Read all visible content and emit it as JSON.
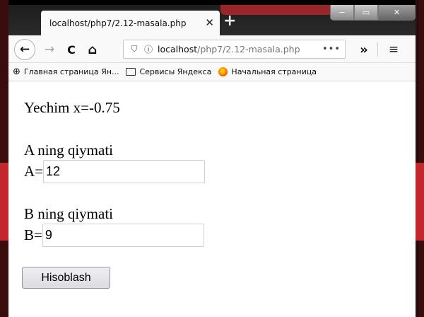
{
  "browser": {
    "tab": {
      "title": "localhost/php7/2.12-masala.php",
      "close_glyph": "✕"
    },
    "new_tab_glyph": "+",
    "window_controls": {
      "minimize": "−",
      "maximize": "▭",
      "close": "✕"
    },
    "nav": {
      "back_glyph": "←",
      "forward_glyph": "→",
      "reload_glyph": "C",
      "home_glyph": "⌂",
      "overflow_glyph": "»",
      "menu_glyph": "≡"
    },
    "url": {
      "host": "localhost",
      "path": "/php7/2.12-masala.php",
      "more": "•••",
      "shield_glyph": "⛉",
      "info_glyph": "ⓘ"
    },
    "bookmarks": [
      {
        "label": "Главная страница Ян...",
        "icon": "globe-icon"
      },
      {
        "label": "Сервисы Яндекса",
        "icon": "folder-icon"
      },
      {
        "label": "Начальная страница",
        "icon": "firefox-icon"
      }
    ]
  },
  "page": {
    "result_text": "Yechim x=-0.75",
    "a_heading": "A ning qiymati",
    "a_prefix": "A=",
    "a_value": "12",
    "b_heading": "B ning qiymati",
    "b_prefix": "B=",
    "b_value": "9",
    "submit_label": "Hisoblash"
  },
  "colors": {
    "tabbar_bg": "#1d1d1d",
    "toolbar_bg": "#f9f9fa",
    "desktop_accent": "#c1272d"
  }
}
